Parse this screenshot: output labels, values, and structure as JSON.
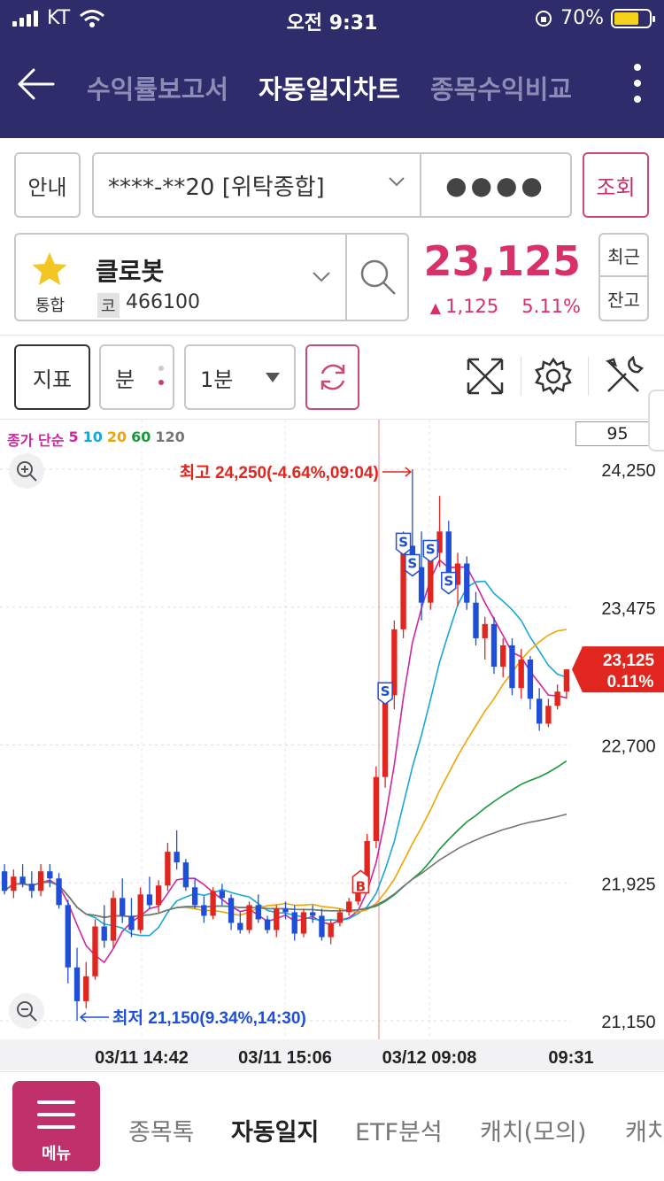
{
  "status_bar": {
    "carrier": "KT",
    "time": "오전 9:31",
    "battery": "70%"
  },
  "header": {
    "tabs": [
      {
        "label": "수익률보고서",
        "active": false
      },
      {
        "label": "자동일지차트",
        "active": true
      },
      {
        "label": "종목수익비교",
        "active": false
      }
    ]
  },
  "account": {
    "guide_label": "안내",
    "account_number": "****-**20 [위탁종합]",
    "password_mask": "●●●●",
    "query_label": "조회"
  },
  "stock": {
    "market_label": "통합",
    "name": "클로봇",
    "code_label": "코",
    "code": "466100",
    "price": "23,125",
    "change": "1,125",
    "change_pct": "5.11%",
    "recent_label": "최근",
    "balance_label": "잔고"
  },
  "toolbar": {
    "indicator_label": "지표",
    "unit_label": "분",
    "interval_value": "1분"
  },
  "chart_data": {
    "type": "candlestick",
    "ma_legend": {
      "prefix": "종가 단순",
      "periods": [
        "5",
        "10",
        "20",
        "60",
        "120"
      ],
      "colors": [
        "#d0259f",
        "#1aa6d6",
        "#f0a500",
        "#169a3a",
        "#777777"
      ]
    },
    "input_box_value": "95",
    "y_ticks": [
      "24,250",
      "23,475",
      "22,700",
      "21,925",
      "21,150"
    ],
    "x_ticks": [
      "03/11 14:42",
      "03/11 15:06",
      "03/12 09:08",
      "09:31"
    ],
    "high_label": "최고 24,250(-4.64%,09:04)",
    "low_label": "최저 21,150(9.34%,14:30)",
    "current_price": "23,125",
    "current_pct": "0.11%",
    "ylim": [
      21150,
      24250
    ],
    "up_color": "#e0261f",
    "down_color": "#1f4fd8",
    "buy_marker": "B",
    "sell_marker": "S",
    "candles": [
      [
        21990,
        22030,
        21860,
        21880
      ],
      [
        21880,
        22000,
        21840,
        21960
      ],
      [
        21960,
        22030,
        21900,
        21920
      ],
      [
        21920,
        21990,
        21840,
        21880
      ],
      [
        21880,
        22030,
        21850,
        21990
      ],
      [
        21990,
        22030,
        21900,
        21950
      ],
      [
        21950,
        21980,
        21780,
        21800
      ],
      [
        21800,
        21830,
        21360,
        21450
      ],
      [
        21450,
        21560,
        21150,
        21260
      ],
      [
        21260,
        21480,
        21220,
        21400
      ],
      [
        21400,
        21720,
        21380,
        21680
      ],
      [
        21680,
        21800,
        21560,
        21600
      ],
      [
        21600,
        21880,
        21560,
        21840
      ],
      [
        21840,
        21950,
        21700,
        21740
      ],
      [
        21740,
        21840,
        21620,
        21660
      ],
      [
        21660,
        21900,
        21640,
        21860
      ],
      [
        21860,
        21960,
        21780,
        21800
      ],
      [
        21800,
        21940,
        21760,
        21910
      ],
      [
        21910,
        22150,
        21880,
        22100
      ],
      [
        22100,
        22220,
        22000,
        22040
      ],
      [
        22040,
        22060,
        21880,
        21900
      ],
      [
        21900,
        21950,
        21780,
        21800
      ],
      [
        21800,
        21850,
        21700,
        21740
      ],
      [
        21740,
        21900,
        21720,
        21880
      ],
      [
        21880,
        21920,
        21800,
        21840
      ],
      [
        21840,
        21860,
        21660,
        21700
      ],
      [
        21700,
        21760,
        21640,
        21660
      ],
      [
        21660,
        21820,
        21640,
        21800
      ],
      [
        21800,
        21860,
        21700,
        21720
      ],
      [
        21720,
        21740,
        21640,
        21660
      ],
      [
        21660,
        21800,
        21620,
        21780
      ],
      [
        21780,
        21820,
        21720,
        21760
      ],
      [
        21760,
        21800,
        21600,
        21640
      ],
      [
        21640,
        21780,
        21620,
        21760
      ],
      [
        21760,
        21800,
        21700,
        21740
      ],
      [
        21740,
        21780,
        21600,
        21620
      ],
      [
        21620,
        21720,
        21580,
        21700
      ],
      [
        21700,
        21780,
        21680,
        21760
      ],
      [
        21760,
        21840,
        21740,
        21820
      ],
      [
        21820,
        21960,
        21800,
        21940
      ],
      [
        21940,
        22200,
        21900,
        22160
      ],
      [
        22160,
        22580,
        22120,
        22520
      ],
      [
        22520,
        23050,
        22460,
        22980
      ],
      [
        22980,
        23400,
        22900,
        23350
      ],
      [
        23350,
        23900,
        23300,
        23820
      ],
      [
        23820,
        24250,
        23700,
        23700
      ],
      [
        23700,
        23900,
        23400,
        23500
      ],
      [
        23500,
        23840,
        23460,
        23780
      ],
      [
        23780,
        24100,
        23700,
        23900
      ],
      [
        23900,
        23960,
        23560,
        23600
      ],
      [
        23600,
        23780,
        23480,
        23720
      ],
      [
        23720,
        23760,
        23460,
        23500
      ],
      [
        23500,
        23560,
        23260,
        23300
      ],
      [
        23300,
        23420,
        23180,
        23380
      ],
      [
        23380,
        23420,
        23100,
        23140
      ],
      [
        23140,
        23300,
        23080,
        23260
      ],
      [
        23260,
        23300,
        22980,
        23020
      ],
      [
        23020,
        23240,
        22960,
        23180
      ],
      [
        23180,
        23200,
        22900,
        22960
      ],
      [
        22960,
        23020,
        22780,
        22820
      ],
      [
        22820,
        22960,
        22800,
        22920
      ],
      [
        22920,
        23040,
        22900,
        23000
      ],
      [
        23000,
        23120,
        22960,
        23125
      ]
    ]
  },
  "bottom_nav": {
    "menu_label": "메뉴",
    "items": [
      {
        "label": "종목톡",
        "active": false
      },
      {
        "label": "자동일지",
        "active": true
      },
      {
        "label": "ETF분석",
        "active": false
      },
      {
        "label": "캐치(모의)",
        "active": false
      },
      {
        "label": "캐치",
        "active": false
      }
    ]
  }
}
